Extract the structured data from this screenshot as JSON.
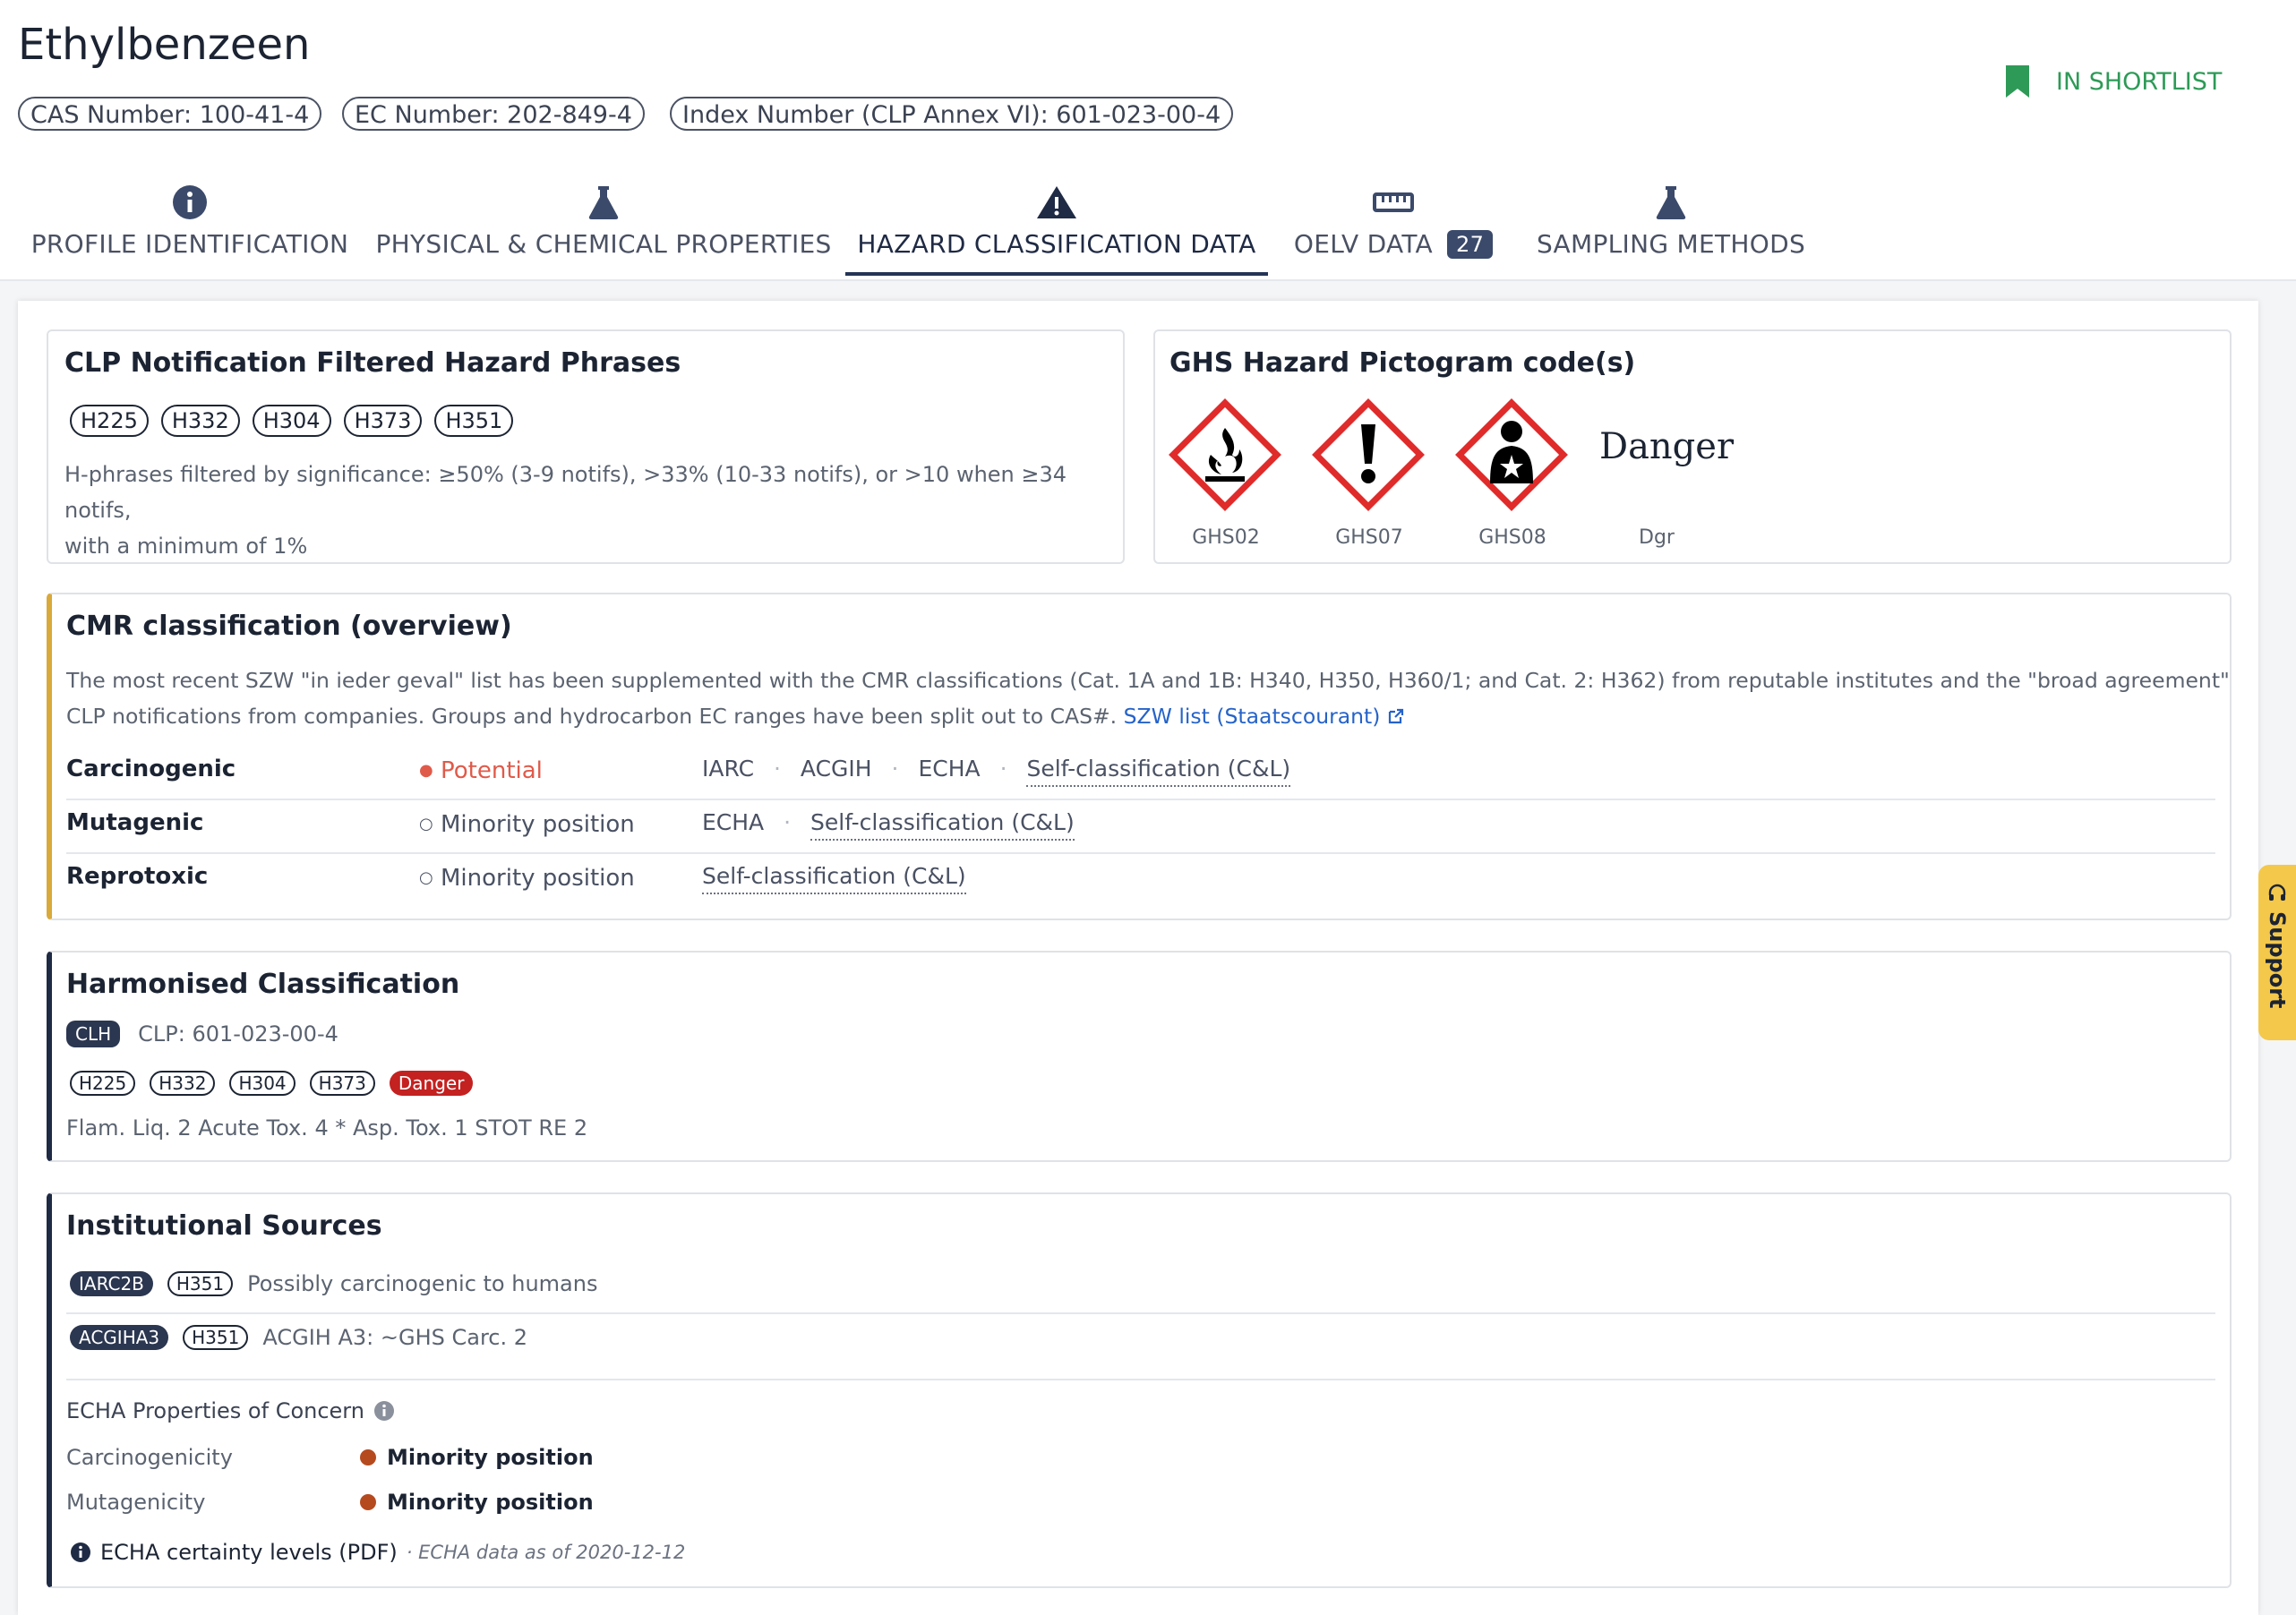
{
  "header": {
    "title": "Ethylbenzeen",
    "ids": [
      "CAS Number: 100-41-4",
      "EC Number: 202-849-4",
      "Index Number (CLP Annex VI): 601-023-00-4"
    ],
    "shortlist_label": "IN SHORTLIST"
  },
  "tabs": [
    {
      "label": "PROFILE IDENTIFICATION",
      "icon": "info-circle-icon"
    },
    {
      "label": "PHYSICAL & CHEMICAL PROPERTIES",
      "icon": "flask-icon"
    },
    {
      "label": "HAZARD CLASSIFICATION DATA",
      "icon": "warning-triangle-icon",
      "active": true
    },
    {
      "label": "OELV DATA",
      "icon": "ruler-icon",
      "badge": "27"
    },
    {
      "label": "SAMPLING METHODS",
      "icon": "flask-icon"
    }
  ],
  "clp": {
    "title": "CLP Notification Filtered Hazard Phrases",
    "phrases": [
      "H225",
      "H332",
      "H304",
      "H373",
      "H351"
    ],
    "note_line1": "H-phrases filtered by significance: ≥50% (3-9 notifs), >33% (10-33 notifs), or >10 when ≥34 notifs,",
    "note_line2": "with a minimum of 1%"
  },
  "ghs": {
    "title": "GHS Hazard Pictogram code(s)",
    "pictograms": [
      {
        "code": "GHS02",
        "icon": "flame-icon"
      },
      {
        "code": "GHS07",
        "icon": "exclamation-icon"
      },
      {
        "code": "GHS08",
        "icon": "health-hazard-icon"
      }
    ],
    "signal_word": "Danger",
    "signal_code": "Dgr"
  },
  "cmr": {
    "title": "CMR classification (overview)",
    "desc_line1": "The most recent SZW \"in ieder geval\" list has been supplemented with the CMR classifications (Cat. 1A and 1B: H340, H350, H360/1; and Cat. 2: H362) from reputable institutes and the \"broad agreement\"",
    "desc_line2": "CLP notifications from companies. Groups and hydrocarbon EC ranges have been split out to CAS#.",
    "link": "SZW list (Staatscourant)",
    "rows": [
      {
        "name": "Carcinogenic",
        "status": "Potential",
        "sources": [
          "IARC",
          "ACGIH",
          "ECHA"
        ],
        "self": "Self-classification (C&L)"
      },
      {
        "name": "Mutagenic",
        "status": "Minority position",
        "sources": [
          "ECHA"
        ],
        "self": "Self-classification (C&L)"
      },
      {
        "name": "Reprotoxic",
        "status": "Minority position",
        "sources": [],
        "self": "Self-classification (C&L)"
      }
    ],
    "colors": {
      "accent": "#d9a93a",
      "potential": "#e05a4a"
    }
  },
  "harmonised": {
    "title": "Harmonised Classification",
    "tag": "CLH",
    "clp_text": "CLP: 601-023-00-4",
    "phrases": [
      "H225",
      "H332",
      "H304",
      "H373"
    ],
    "danger": "Danger",
    "classes": "Flam. Liq. 2 Acute Tox. 4 * Asp. Tox. 1 STOT RE 2"
  },
  "institutional": {
    "title": "Institutional Sources",
    "rows": [
      {
        "tag": "IARC2B",
        "phrase": "H351",
        "text": "Possibly carcinogenic to humans"
      },
      {
        "tag": "ACGIHA3",
        "phrase": "H351",
        "text": "ACGIH A3: ~GHS Carc. 2"
      }
    ],
    "echa_title": "ECHA Properties of Concern",
    "echa_rows": [
      {
        "name": "Carcinogenicity",
        "value": "Minority position"
      },
      {
        "name": "Mutagenicity",
        "value": "Minority position"
      }
    ],
    "echa_link": "ECHA certainty levels (PDF)",
    "echa_date": "· ECHA data as of 2020-12-12",
    "colors": {
      "accent": "#1f2a44",
      "dot": "#b54a1f"
    }
  },
  "support": {
    "label": "Support"
  }
}
